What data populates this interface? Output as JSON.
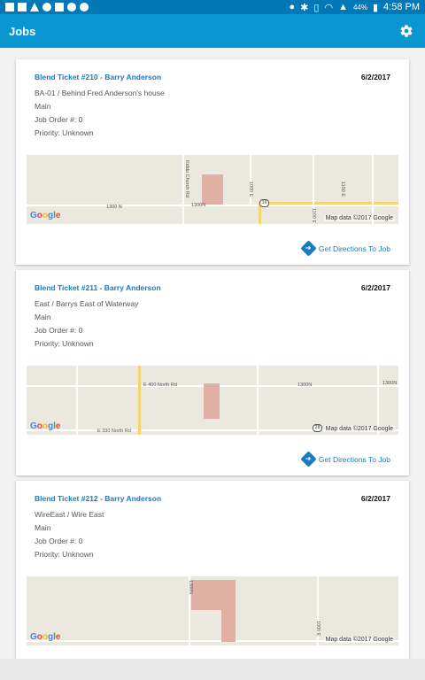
{
  "status_bar": {
    "battery": "44%",
    "time": "4:58 PM"
  },
  "app_bar": {
    "title": "Jobs",
    "settings_icon": "gear-icon"
  },
  "jobs": [
    {
      "ticket": "Blend Ticket #210  - Barry Anderson",
      "date": "6/2/2017",
      "location": "BA-01 /  Behind Fred Anderson's house",
      "area": "Main",
      "job_order": "Job Order #: 0",
      "priority": "Priority: Unknown",
      "map": {
        "labels": [
          "Kiddo Church Rd",
          "1300N",
          "1300 N",
          "1000 E",
          "1150 E",
          "1100 E",
          "16"
        ],
        "attribution": "Map data ©2017 Google"
      },
      "directions_label": "Get Directions To Job"
    },
    {
      "ticket": "Blend Ticket #211  - Barry Anderson",
      "date": "6/2/2017",
      "location": "East /  Barrys East of Waterway",
      "area": "Main",
      "job_order": "Job Order #: 0",
      "priority": "Priority: Unknown",
      "map": {
        "labels": [
          "E 400 North Rd",
          "1300N",
          "1300N",
          "E 330 North Rd",
          "28"
        ],
        "attribution": "Map data ©2017 Google"
      },
      "directions_label": "Get Directions To Job"
    },
    {
      "ticket": "Blend Ticket #212  - Barry Anderson",
      "date": "6/2/2017",
      "location": "WireEast /  Wire East",
      "area": "Main",
      "job_order": "Job Order #: 0",
      "priority": "Priority: Unknown",
      "map": {
        "labels": [
          "1300N",
          "1000 E"
        ],
        "attribution": "Map data ©2017 Google"
      }
    }
  ],
  "google_logo": "Google",
  "colors": {
    "status_bar": "#0279b6",
    "app_bar": "#0a96d1",
    "link": "#1b7bbd"
  }
}
